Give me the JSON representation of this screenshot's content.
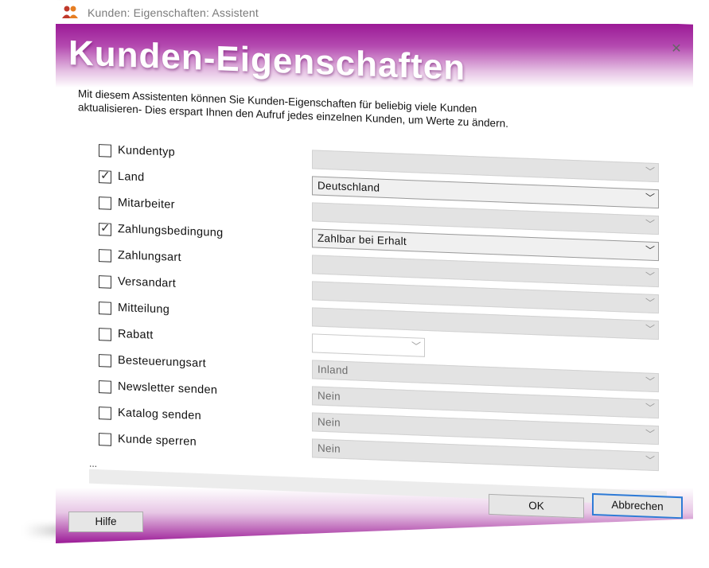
{
  "window": {
    "title": "Kunden: Eigenschaften: Assistent",
    "close_glyph": "✕",
    "icon": "people-icon"
  },
  "banner": {
    "title": "Kunden-Eigenschaften"
  },
  "intro": {
    "line1": "Mit diesem Assistenten können Sie Kunden-Eigenschaften für beliebig viele Kunden",
    "line2": "aktualisieren- Dies erspart Ihnen den Aufruf jedes einzelnen Kunden, um Werte zu ändern."
  },
  "fields": [
    {
      "label": "Kundentyp",
      "checked": false,
      "value": ""
    },
    {
      "label": "Land",
      "checked": true,
      "value": "Deutschland"
    },
    {
      "label": "Mitarbeiter",
      "checked": false,
      "value": ""
    },
    {
      "label": "Zahlungsbedingung",
      "checked": true,
      "value": "Zahlbar bei Erhalt"
    },
    {
      "label": "Zahlungsart",
      "checked": false,
      "value": ""
    },
    {
      "label": "Versandart",
      "checked": false,
      "value": ""
    },
    {
      "label": "Mitteilung",
      "checked": false,
      "value": ""
    },
    {
      "label": "Rabatt",
      "checked": false,
      "value": ""
    },
    {
      "label": "Besteuerungsart",
      "checked": false,
      "value": "Inland"
    },
    {
      "label": "Newsletter senden",
      "checked": false,
      "value": "Nein"
    },
    {
      "label": "Katalog senden",
      "checked": false,
      "value": "Nein"
    },
    {
      "label": "Kunde sperren",
      "checked": false,
      "value": "Nein"
    }
  ],
  "status": {
    "text": "..."
  },
  "buttons": {
    "ok": "OK",
    "cancel": "Abbrechen",
    "help": "Hilfe"
  },
  "colors": {
    "accent": "#9b1a96",
    "default_button_border": "#2e7bd6"
  }
}
